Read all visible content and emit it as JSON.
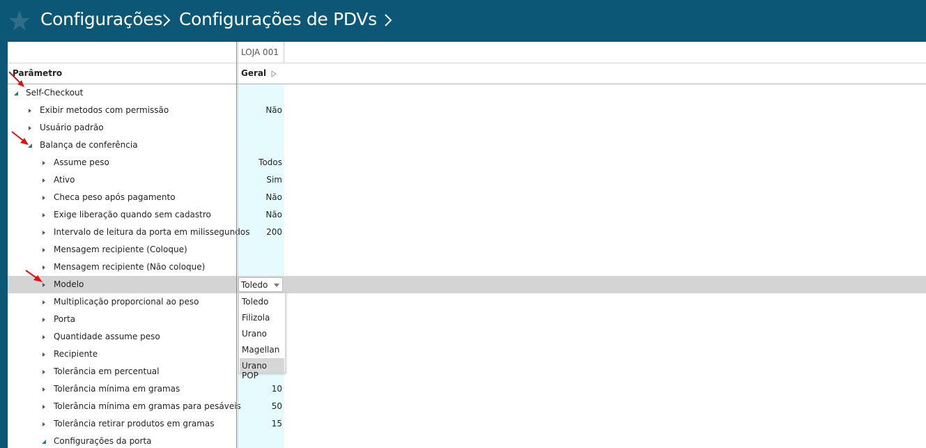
{
  "breadcrumb": {
    "items": [
      "Configurações",
      "Configurações de PDVs"
    ]
  },
  "columns": {
    "store": "LOJA 001",
    "parameter": "Parâmetro",
    "group": "Geral"
  },
  "rows": [
    {
      "label": "Self-Checkout",
      "value": "",
      "level": 0,
      "expanded": true
    },
    {
      "label": "Exibir metodos com permissão",
      "value": "Não",
      "level": 1,
      "expanded": false
    },
    {
      "label": "Usuário padrão",
      "value": "",
      "level": 1,
      "expanded": false
    },
    {
      "label": "Balança de conferência",
      "value": "",
      "level": 1,
      "expanded": true
    },
    {
      "label": "Assume peso",
      "value": "Todos",
      "level": 2,
      "expanded": false
    },
    {
      "label": "Ativo",
      "value": "Sim",
      "level": 2,
      "expanded": false
    },
    {
      "label": "Checa peso após pagamento",
      "value": "Não",
      "level": 2,
      "expanded": false
    },
    {
      "label": "Exige liberação quando sem cadastro",
      "value": "Não",
      "level": 2,
      "expanded": false
    },
    {
      "label": "Intervalo de leitura da porta em milissegundos",
      "value": "200",
      "level": 2,
      "expanded": false
    },
    {
      "label": "Mensagem recipiente (Coloque)",
      "value": "",
      "level": 2,
      "expanded": false
    },
    {
      "label": "Mensagem recipiente (Não coloque)",
      "value": "",
      "level": 2,
      "expanded": false
    },
    {
      "label": "Modelo",
      "value": "Toledo",
      "level": 2,
      "expanded": false,
      "selected": true
    },
    {
      "label": "Multiplicação proporcional ao peso",
      "value": "",
      "level": 2,
      "expanded": false
    },
    {
      "label": "Porta",
      "value": "",
      "level": 2,
      "expanded": false
    },
    {
      "label": "Quantidade assume peso",
      "value": "",
      "level": 2,
      "expanded": false
    },
    {
      "label": "Recipiente",
      "value": "",
      "level": 2,
      "expanded": false
    },
    {
      "label": "Tolerância em percentual",
      "value": "",
      "level": 2,
      "expanded": false
    },
    {
      "label": "Tolerância mínima em gramas",
      "value": "10",
      "level": 2,
      "expanded": false
    },
    {
      "label": "Tolerância mínima em gramas para pesáveis",
      "value": "50",
      "level": 2,
      "expanded": false
    },
    {
      "label": "Tolerância retirar produtos em gramas",
      "value": "15",
      "level": 2,
      "expanded": false
    },
    {
      "label": "Configurações da porta",
      "value": "",
      "level": 2,
      "expanded": true
    }
  ],
  "modelo_select": {
    "selected": "Toledo",
    "options": [
      "Toledo",
      "Filizola",
      "Urano",
      "Magellan",
      "Urano POP"
    ],
    "highlighted": "Urano POP"
  },
  "colors": {
    "header_bg": "#0b5775",
    "value_column_bg": "#e6fbfd",
    "selected_row_bg": "#d4d4d4",
    "expander_teal": "#1a7d8c",
    "annotation_arrow": "#e01010"
  }
}
